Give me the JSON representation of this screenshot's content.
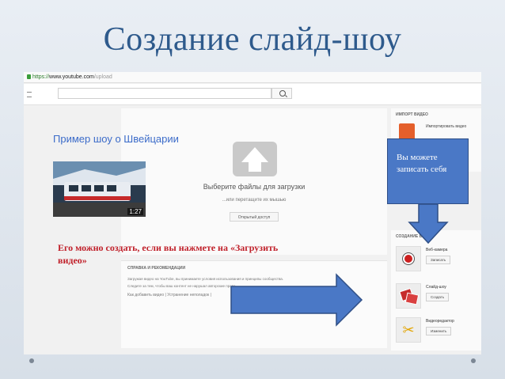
{
  "slide": {
    "title": "Создание слайд-шоу"
  },
  "browser": {
    "url_scheme": "https://",
    "url_host": "www.youtube.com",
    "url_path": "/upload"
  },
  "upload": {
    "select_files_label": "Выберите файлы для загрузки",
    "drag_hint": "...или перетащите их мышью",
    "privacy_value": "Открытый доступ"
  },
  "help": {
    "title": "СПРАВКА И РЕКОМЕНДАЦИИ",
    "line1": "Загружая видео на YouTube, вы принимаете условия использования и принципы сообщества.",
    "line2": "Следите за тем, чтобы ваш контент не нарушал авторские права.",
    "links": "Как добавить видео  |  Устранение неполадок  |"
  },
  "sidebar": {
    "import_heading": "ИМПОРТ ВИДЕО",
    "import_item": "Импортировать видео",
    "create_heading": "СОЗДАНИЕ ВИДЕО",
    "tools": [
      {
        "name": "Веб-камера",
        "button": "Записать"
      },
      {
        "name": "Слайд-шоу",
        "button": "Создать"
      },
      {
        "name": "Видеоредактор",
        "button": "Изменить"
      }
    ]
  },
  "example": {
    "link_text": "Пример шоу о Швейцарии",
    "duration": "1:27"
  },
  "instruction": "Его можно создать, если вы нажмете на «Загрузить видео»",
  "callout": "Вы можете записать себя",
  "colors": {
    "title": "#2e5a8c",
    "callout_fill": "#4a78c6",
    "instruction_text": "#c0202a",
    "link": "#3b6bc9",
    "webcam_record": "#cc1f1f",
    "slideshow_icon": "#c62a2a",
    "editor_icon": "#e3a400"
  },
  "icons": [
    "menu-icon",
    "search-icon",
    "upload-arrow-icon",
    "import-video-icon",
    "webcam-icon",
    "slideshow-icon",
    "scissors-icon",
    "down-arrow-icon",
    "right-arrow-icon"
  ]
}
